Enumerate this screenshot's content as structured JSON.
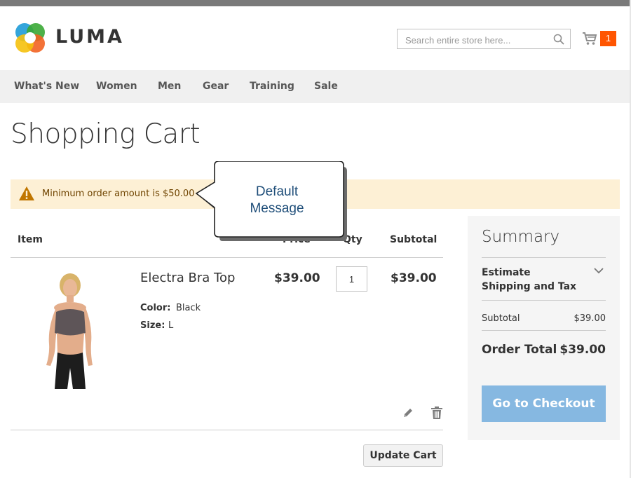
{
  "header": {
    "logo_text": "LUMA",
    "search_placeholder": "Search entire store here...",
    "cart_count": "1"
  },
  "nav": {
    "items": [
      "What's New",
      "Women",
      "Men",
      "Gear",
      "Training",
      "Sale"
    ]
  },
  "page": {
    "title": "Shopping Cart"
  },
  "message": {
    "text": "Minimum order amount is $50.00"
  },
  "callout": {
    "line1": "Default",
    "line2": "Message"
  },
  "cart": {
    "columns": [
      "Item",
      "Price",
      "Qty",
      "Subtotal"
    ],
    "item": {
      "name": "Electra Bra Top",
      "options": [
        {
          "label": "Color:",
          "value": "Black"
        },
        {
          "label": "Size:",
          "value": "L"
        }
      ],
      "price": "$39.00",
      "qty": "1",
      "subtotal": "$39.00"
    },
    "update_label": "Update Cart"
  },
  "summary": {
    "title": "Summary",
    "estimate_label": "Estimate Shipping and Tax",
    "subtotal_label": "Subtotal",
    "subtotal_value": "$39.00",
    "total_label": "Order Total",
    "total_value": "$39.00",
    "checkout_label": "Go to Checkout"
  },
  "colors": {
    "accent_orange": "#ff5501",
    "checkout_blue": "#86b8e1",
    "message_bg": "#fdf0d5"
  },
  "icons": [
    "luma-logo-icon",
    "search-icon",
    "cart-icon",
    "warning-icon",
    "chevron-down-icon",
    "edit-icon",
    "trash-icon"
  ]
}
